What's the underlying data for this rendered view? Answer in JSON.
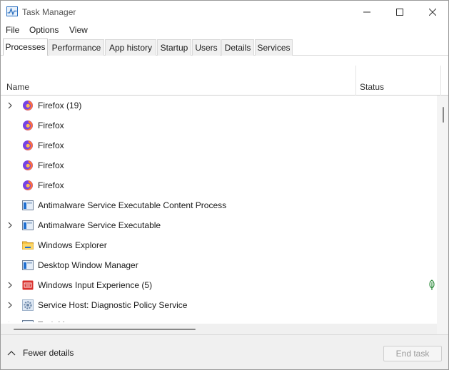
{
  "window": {
    "title": "Task Manager",
    "app_icon": "task-manager-icon",
    "controls": [
      "minimize-icon",
      "maximize-icon",
      "close-icon"
    ]
  },
  "menu": {
    "file": "File",
    "options": "Options",
    "view": "View"
  },
  "tabs": [
    {
      "label": "Processes",
      "active": true
    },
    {
      "label": "Performance",
      "active": false
    },
    {
      "label": "App history",
      "active": false
    },
    {
      "label": "Startup",
      "active": false
    },
    {
      "label": "Users",
      "active": false
    },
    {
      "label": "Details",
      "active": false
    },
    {
      "label": "Services",
      "active": false
    }
  ],
  "columns": {
    "name": "Name",
    "status": "Status"
  },
  "processes": [
    {
      "name": "Firefox (19)",
      "icon": "firefox-icon",
      "expandable": true,
      "status_icon": ""
    },
    {
      "name": "Firefox",
      "icon": "firefox-icon",
      "expandable": false,
      "status_icon": ""
    },
    {
      "name": "Firefox",
      "icon": "firefox-icon",
      "expandable": false,
      "status_icon": ""
    },
    {
      "name": "Firefox",
      "icon": "firefox-icon",
      "expandable": false,
      "status_icon": ""
    },
    {
      "name": "Firefox",
      "icon": "firefox-icon",
      "expandable": false,
      "status_icon": ""
    },
    {
      "name": "Antimalware Service Executable Content Process",
      "icon": "service-window-icon",
      "expandable": false,
      "status_icon": ""
    },
    {
      "name": "Antimalware Service Executable",
      "icon": "service-window-icon",
      "expandable": true,
      "status_icon": ""
    },
    {
      "name": "Windows Explorer",
      "icon": "folder-icon",
      "expandable": false,
      "status_icon": ""
    },
    {
      "name": "Desktop Window Manager",
      "icon": "service-window-icon",
      "expandable": false,
      "status_icon": ""
    },
    {
      "name": "Windows Input Experience (5)",
      "icon": "keyboard-icon",
      "expandable": true,
      "status_icon": "efficiency-leaf-icon"
    },
    {
      "name": "Service Host: Diagnostic Policy Service",
      "icon": "gear-icon",
      "expandable": true,
      "status_icon": ""
    },
    {
      "name": "Task Manager",
      "icon": "service-window-icon",
      "expandable": true,
      "status_icon": ""
    }
  ],
  "footer": {
    "fewer_details": "Fewer details",
    "end_task": "End task"
  },
  "colors": {
    "firefox_orange": "#ff7139",
    "firefox_purple": "#7542e5",
    "service_blue": "#1f6fd1",
    "folder_yellow": "#f6c342",
    "input_red": "#d9302c",
    "leaf_green": "#2e8b3d"
  }
}
